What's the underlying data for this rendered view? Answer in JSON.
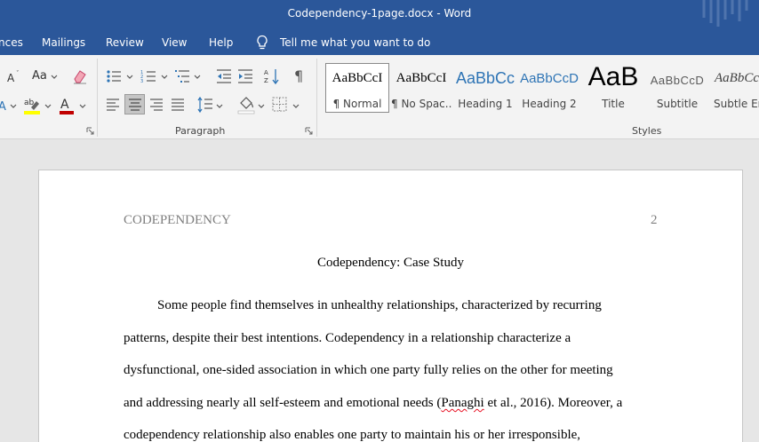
{
  "window": {
    "title": "Codependency-1page.docx  -  Word"
  },
  "ribbon_tabs": [
    {
      "label": "nces"
    },
    {
      "label": "Mailings"
    },
    {
      "label": "Review"
    },
    {
      "label": "View"
    },
    {
      "label": "Help"
    }
  ],
  "tell_me": {
    "label": "Tell me what you want to do"
  },
  "font_group": {
    "change_case_label": "Aa"
  },
  "groups": {
    "paragraph_label": "Paragraph",
    "styles_label": "Styles"
  },
  "styles": [
    {
      "preview": "AaBbCcI",
      "name": "¶ Normal",
      "selected": true
    },
    {
      "preview": "AaBbCcI",
      "name": "¶ No Spac..."
    },
    {
      "preview": "AaBbCc",
      "name": "Heading 1",
      "color": "#2e74b5"
    },
    {
      "preview": "AaBbCcD",
      "name": "Heading 2",
      "color": "#2e74b5"
    },
    {
      "preview": "AaB",
      "name": "Title"
    },
    {
      "preview": "AaBbCcD",
      "name": "Subtitle",
      "color": "#5a5a5a"
    },
    {
      "preview": "AaBbCcDi",
      "name": "Subtle Em..."
    }
  ],
  "colors": {
    "title_bar": "#2b579a",
    "highlight": "#ffff00",
    "font_color": "#c00000"
  },
  "document": {
    "running_head": "CODEPENDENCY",
    "page_number": "2",
    "title": "Codependency: Case Study",
    "lines": [
      "Some people find themselves in unhealthy relationships, characterized by recurring",
      "patterns, despite their best intentions. Codependency in a relationship characterize a",
      "dysfunctional, one-sided association in which one party fully relies on the other for meeting"
    ],
    "line4_before": "and addressing nearly all self-esteem and emotional needs (",
    "line4_misspelled": "Panaghi",
    "line4_after": " et al., 2016). Moreover, a",
    "line5": "codependency relationship also enables one party to maintain his or her irresponsible,"
  }
}
